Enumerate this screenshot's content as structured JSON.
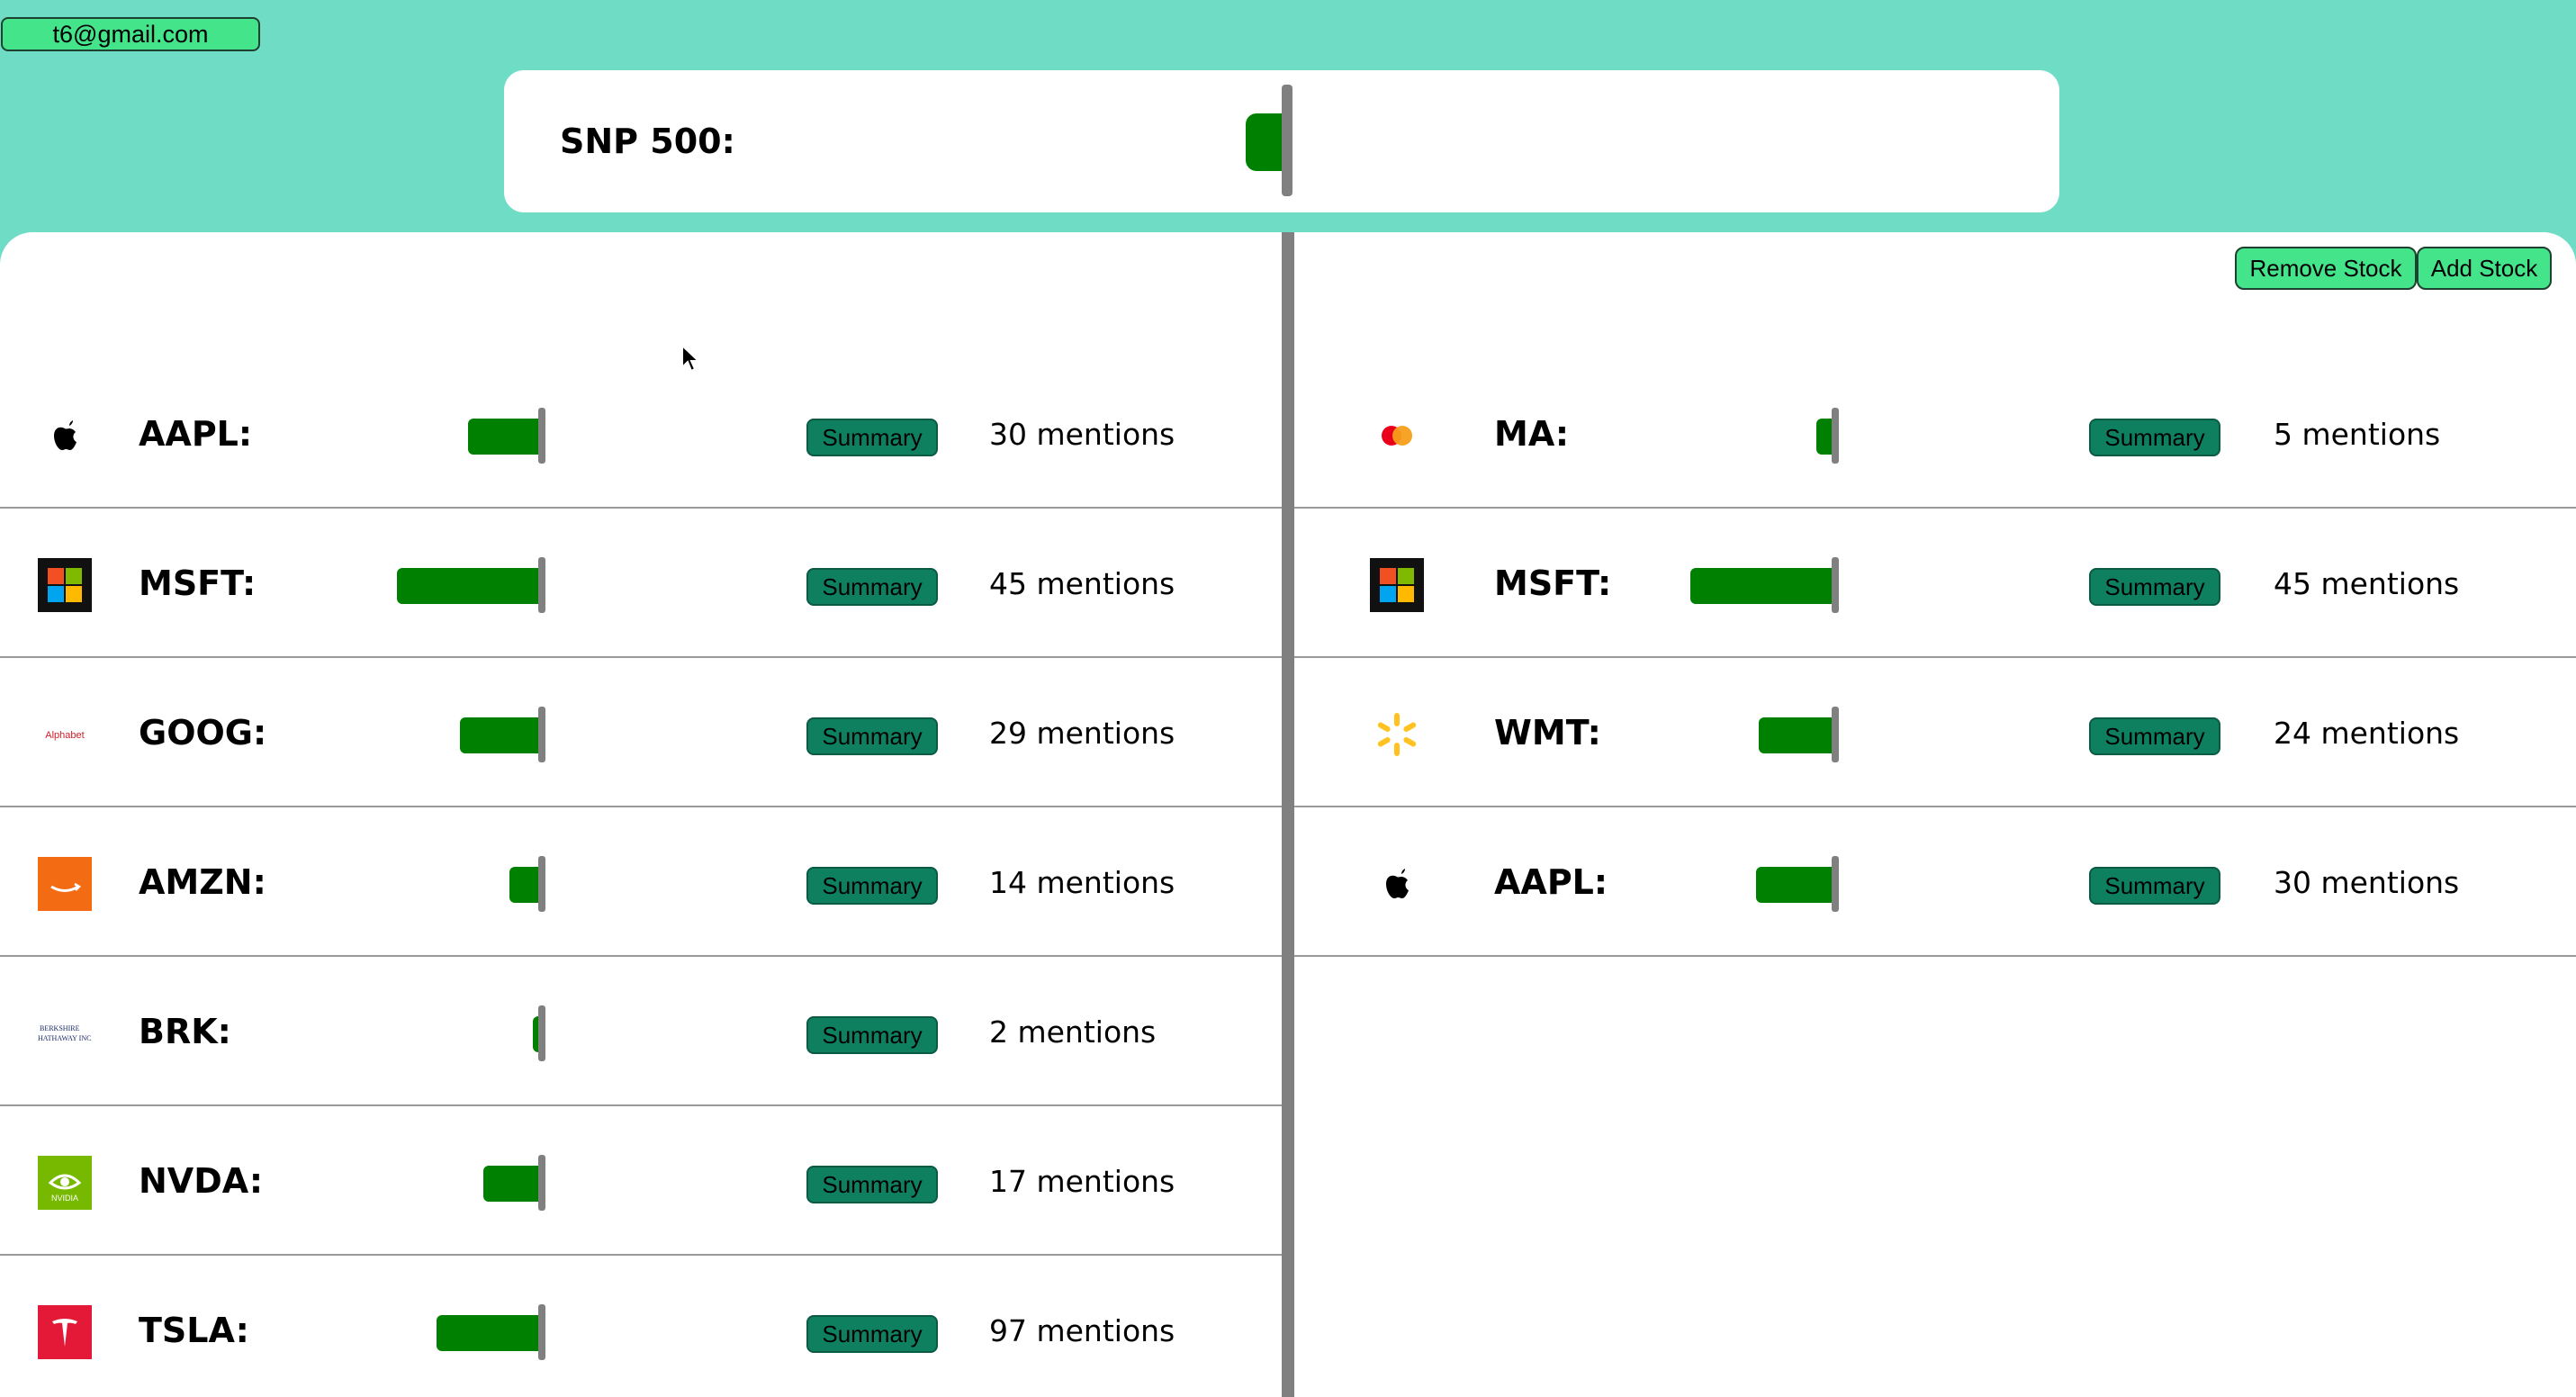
{
  "header": {
    "email": "t6@gmail.com",
    "snp_label": "SNP 500:",
    "snp_level": 0.1
  },
  "toolbar": {
    "remove_label": "Remove Stock",
    "add_label": "Add Stock"
  },
  "summary_label": "Summary",
  "colors": {
    "background": "#6fdcc6",
    "bar": "#008000",
    "summary_bg": "#0e8060",
    "button": "#44e48a"
  },
  "left_stocks": [
    {
      "logo": "apple-logo-icon",
      "ticker": "AAPL:",
      "level": 0.27,
      "mentions": "30 mentions"
    },
    {
      "logo": "microsoft-logo-icon",
      "ticker": "MSFT:",
      "level": 0.54,
      "mentions": "45 mentions"
    },
    {
      "logo": "alphabet-logo-icon",
      "logo_text": "Alphabet",
      "ticker": "GOOG:",
      "level": 0.3,
      "mentions": "29 mentions"
    },
    {
      "logo": "amazon-logo-icon",
      "ticker": "AMZN:",
      "level": 0.11,
      "mentions": "14 mentions"
    },
    {
      "logo": "berkshire-logo-icon",
      "logo_text": "Berkshire Hathaway",
      "ticker": "BRK:",
      "level": 0.02,
      "mentions": "2 mentions"
    },
    {
      "logo": "nvidia-logo-icon",
      "ticker": "NVDA:",
      "level": 0.21,
      "mentions": "17 mentions"
    },
    {
      "logo": "tesla-logo-icon",
      "ticker": "TSLA:",
      "level": 0.39,
      "mentions": "97 mentions"
    }
  ],
  "right_stocks": [
    {
      "logo": "mastercard-logo-icon",
      "ticker": "MA:",
      "level": 0.06,
      "mentions": "5 mentions"
    },
    {
      "logo": "microsoft-logo-icon",
      "ticker": "MSFT:",
      "level": 0.54,
      "mentions": "45 mentions"
    },
    {
      "logo": "walmart-logo-icon",
      "ticker": "WMT:",
      "level": 0.28,
      "mentions": "24 mentions"
    },
    {
      "logo": "apple-logo-icon",
      "ticker": "AAPL:",
      "level": 0.29,
      "mentions": "30 mentions"
    }
  ]
}
